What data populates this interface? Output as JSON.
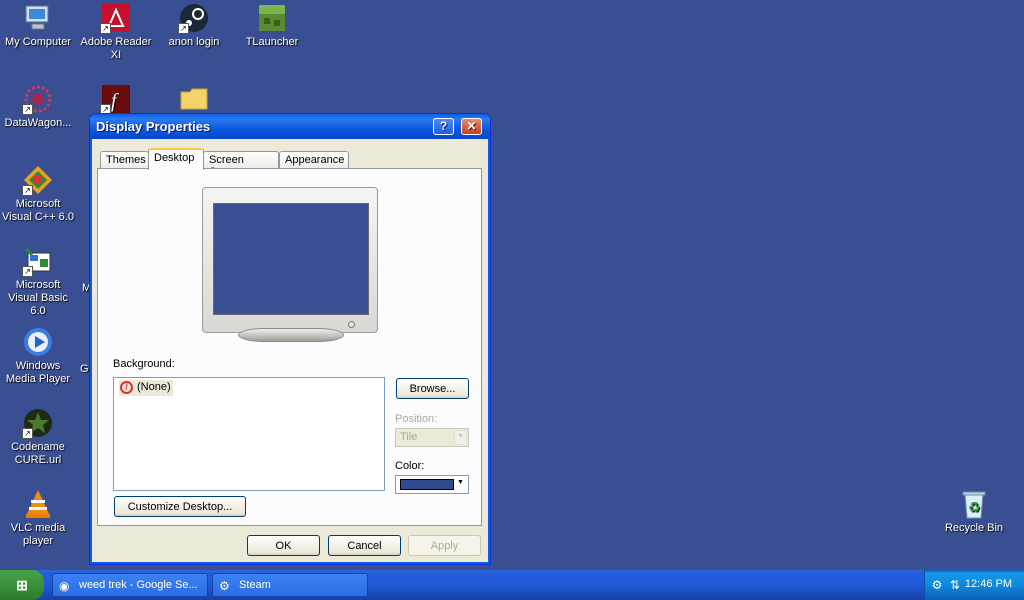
{
  "desktop": {
    "icons": [
      {
        "label": "My Computer",
        "glyph": "🖥"
      },
      {
        "label": "Adobe Reader XI",
        "glyph": "A"
      },
      {
        "label": "anon login",
        "glyph": "⚙"
      },
      {
        "label": "TLauncher",
        "glyph": "▦"
      },
      {
        "label": "DataWagon...",
        "glyph": "✺"
      },
      {
        "label": "",
        "glyph": "ƒ"
      },
      {
        "label": "",
        "glyph": "📁"
      },
      {
        "label": "Microsoft Visual C++ 6.0",
        "glyph": "◆"
      },
      {
        "label": "Microsoft Visual Basic 6.0",
        "glyph": "▣"
      },
      {
        "label": "Windows Media Player",
        "glyph": "▶"
      },
      {
        "label": "Codename CURE.url",
        "glyph": "★"
      },
      {
        "label": "VLC media player",
        "glyph": "▲"
      },
      {
        "label": "Recycle Bin",
        "glyph": "♻"
      }
    ],
    "partial_labels": [
      "M",
      "G"
    ]
  },
  "dialog": {
    "title": "Display Properties",
    "help_glyph": "?",
    "close_glyph": "✕",
    "tabs": [
      "Themes",
      "Desktop",
      "Screen Saver",
      "Appearance"
    ],
    "active_tab": "Desktop",
    "background_label": "Background:",
    "background_items": [
      "(None)"
    ],
    "browse_button": "Browse...",
    "position_label": "Position:",
    "position_value": "Tile",
    "color_label": "Color:",
    "color_value": "#2f4a8f",
    "customize_button": "Customize Desktop...",
    "ok_button": "OK",
    "cancel_button": "Cancel",
    "apply_button": "Apply"
  },
  "taskbar": {
    "start_glyph": "⊞",
    "tasks": [
      {
        "label": "weed trek - Google Se...",
        "glyph": "◉"
      },
      {
        "label": "Steam",
        "glyph": "⚙"
      }
    ],
    "clock": "12:46 PM"
  },
  "colors": {
    "desktop": "#3a4f92",
    "accent": "#0a5ee8"
  }
}
